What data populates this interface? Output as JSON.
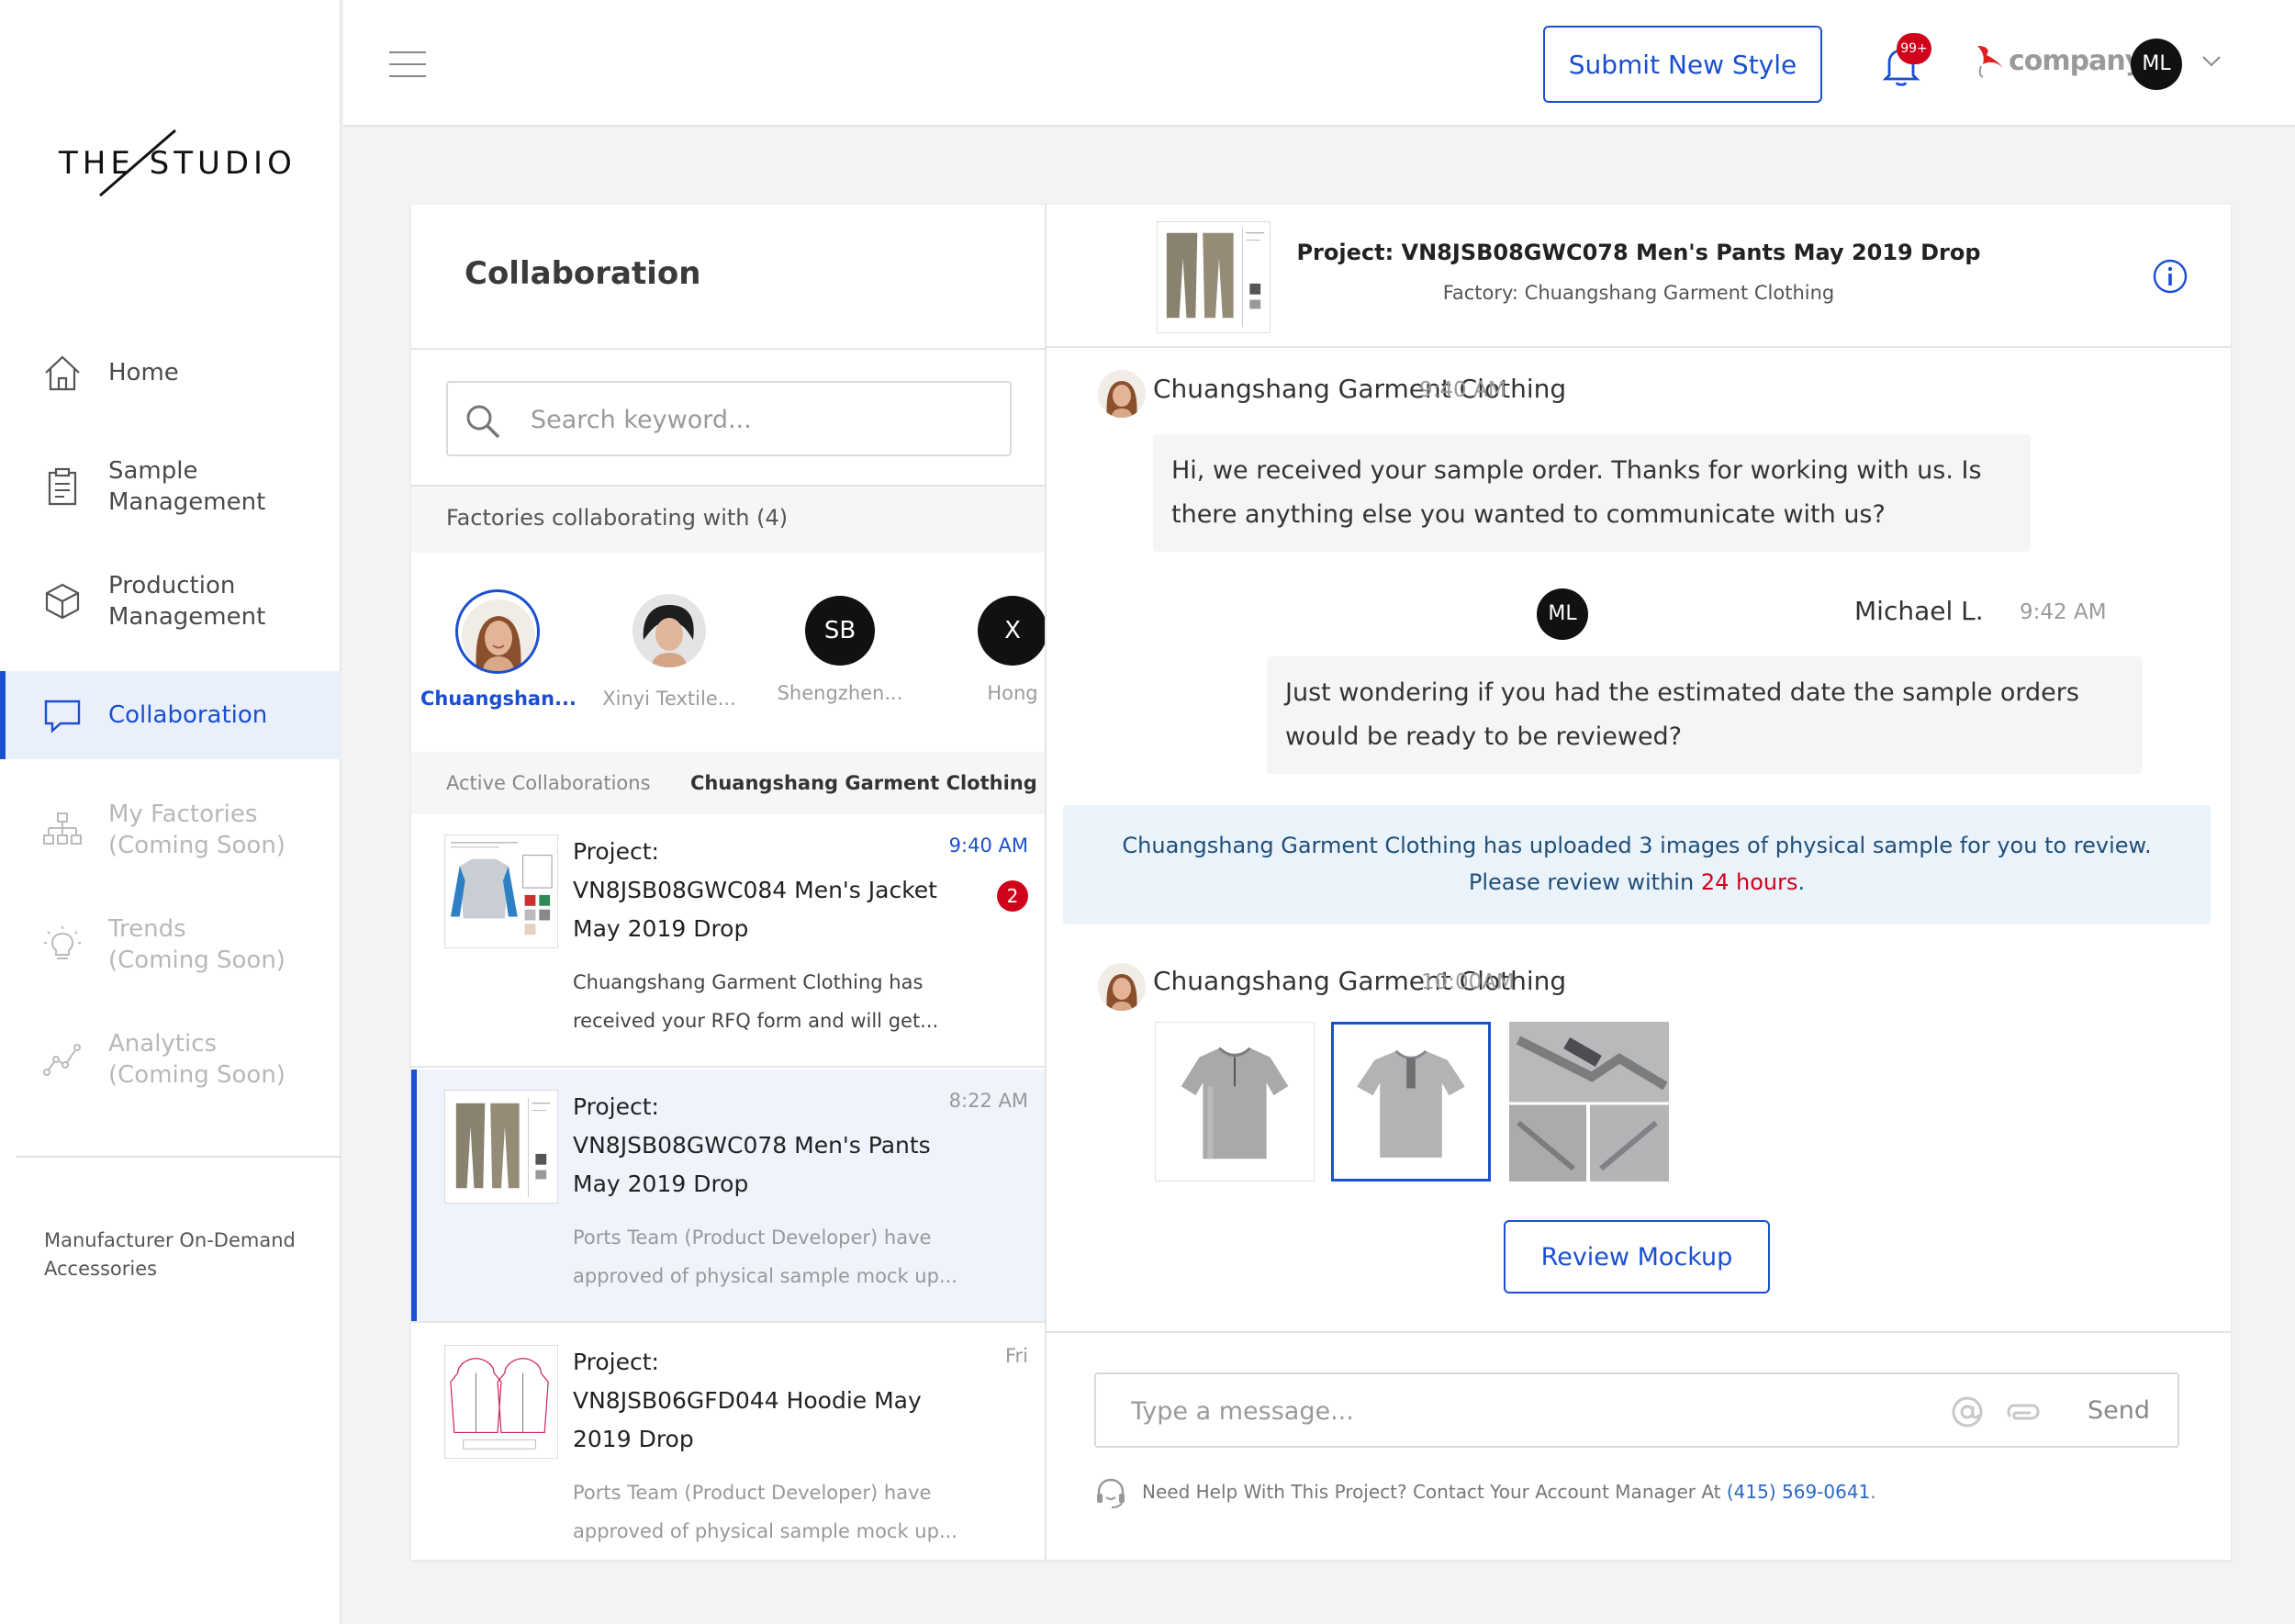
{
  "brand": {
    "logo_text": "THE STUDIO"
  },
  "sidebar": {
    "items": [
      {
        "label": "Home",
        "icon": "home-icon"
      },
      {
        "label": "Sample\nManagement",
        "icon": "clipboard-icon"
      },
      {
        "label": "Production\nManagement",
        "icon": "box-icon"
      },
      {
        "label": "Collaboration",
        "icon": "chat-icon",
        "active": true
      },
      {
        "label": "My Factories\n(Coming Soon)",
        "icon": "org-chart-icon",
        "disabled": true
      },
      {
        "label": "Trends\n(Coming Soon)",
        "icon": "lightbulb-icon",
        "disabled": true
      },
      {
        "label": "Analytics\n(Coming Soon)",
        "icon": "analytics-icon",
        "disabled": true
      }
    ],
    "footer": "Manufacturer On-Demand Accessories"
  },
  "topbar": {
    "submit_label": "Submit New Style",
    "notifications_badge": "99+",
    "company_name": "company",
    "user_initials": "ML"
  },
  "collaboration": {
    "title": "Collaboration",
    "search_placeholder": "Search keyword...",
    "factories_heading": "Factories collaborating with (4)",
    "factories": [
      {
        "name": "Chuangshan...",
        "selected": true
      },
      {
        "name": "Xinyi Textile..."
      },
      {
        "name": "Shengzhen...",
        "initials": "SB"
      },
      {
        "name": "Hong",
        "initials": "X"
      }
    ],
    "active_label": "Active Collaborations",
    "active_factory": "Chuangshang Garment Clothing",
    "threads": [
      {
        "title": "Project:\nVN8JSB08GWC084 Men's Jacket May 2019 Drop",
        "time": "9:40 AM",
        "badge": "2",
        "preview": "Chuangshang Garment Clothing has received your RFQ form and will get..."
      },
      {
        "title": "Project:\nVN8JSB08GWC078 Men's Pants May 2019 Drop",
        "time": "8:22 AM",
        "preview": "Ports Team (Product Developer) have approved of physical sample mock up..."
      },
      {
        "title": "Project:\nVN8JSB06GFD044 Hoodie May 2019 Drop",
        "time": "Fri",
        "preview": "Ports Team (Product Developer) have approved of physical sample mock up..."
      }
    ]
  },
  "chat": {
    "project_title": "Project: VN8JSB08GWC078 Men's Pants May 2019 Drop",
    "factory_line": "Factory: Chuangshang Garment Clothing",
    "messages": [
      {
        "sender": "Chuangshang Garment Clothing",
        "time": "9:40 AM",
        "text": "Hi, we received your sample order. Thanks for working with us. Is there anything else you wanted to communicate with us?"
      },
      {
        "sender": "Michael L.",
        "initials": "ML",
        "time": "9:42 AM",
        "text": "Just wondering if you had the estimated date the sample orders would be ready to be reviewed?"
      },
      {
        "sender": "Chuangshang Garment Clothing",
        "time": "10:00AM"
      }
    ],
    "notice_main": "Chuangshang Garment Clothing has uploaded 3 images of physical sample for you to review.",
    "notice_prefix": "Please review within ",
    "notice_deadline": "24 hours",
    "notice_suffix": ".",
    "review_label": "Review Mockup",
    "compose_placeholder": "Type a message...",
    "send_label": "Send",
    "help_text": "Need Help With This Project? Contact Your Account Manager At ",
    "help_phone": "(415) 569-0641",
    "help_suffix": "."
  },
  "colors": {
    "accent": "#1a4fd1",
    "alert": "#d0021b",
    "notice_bg": "#eaf2fa"
  }
}
